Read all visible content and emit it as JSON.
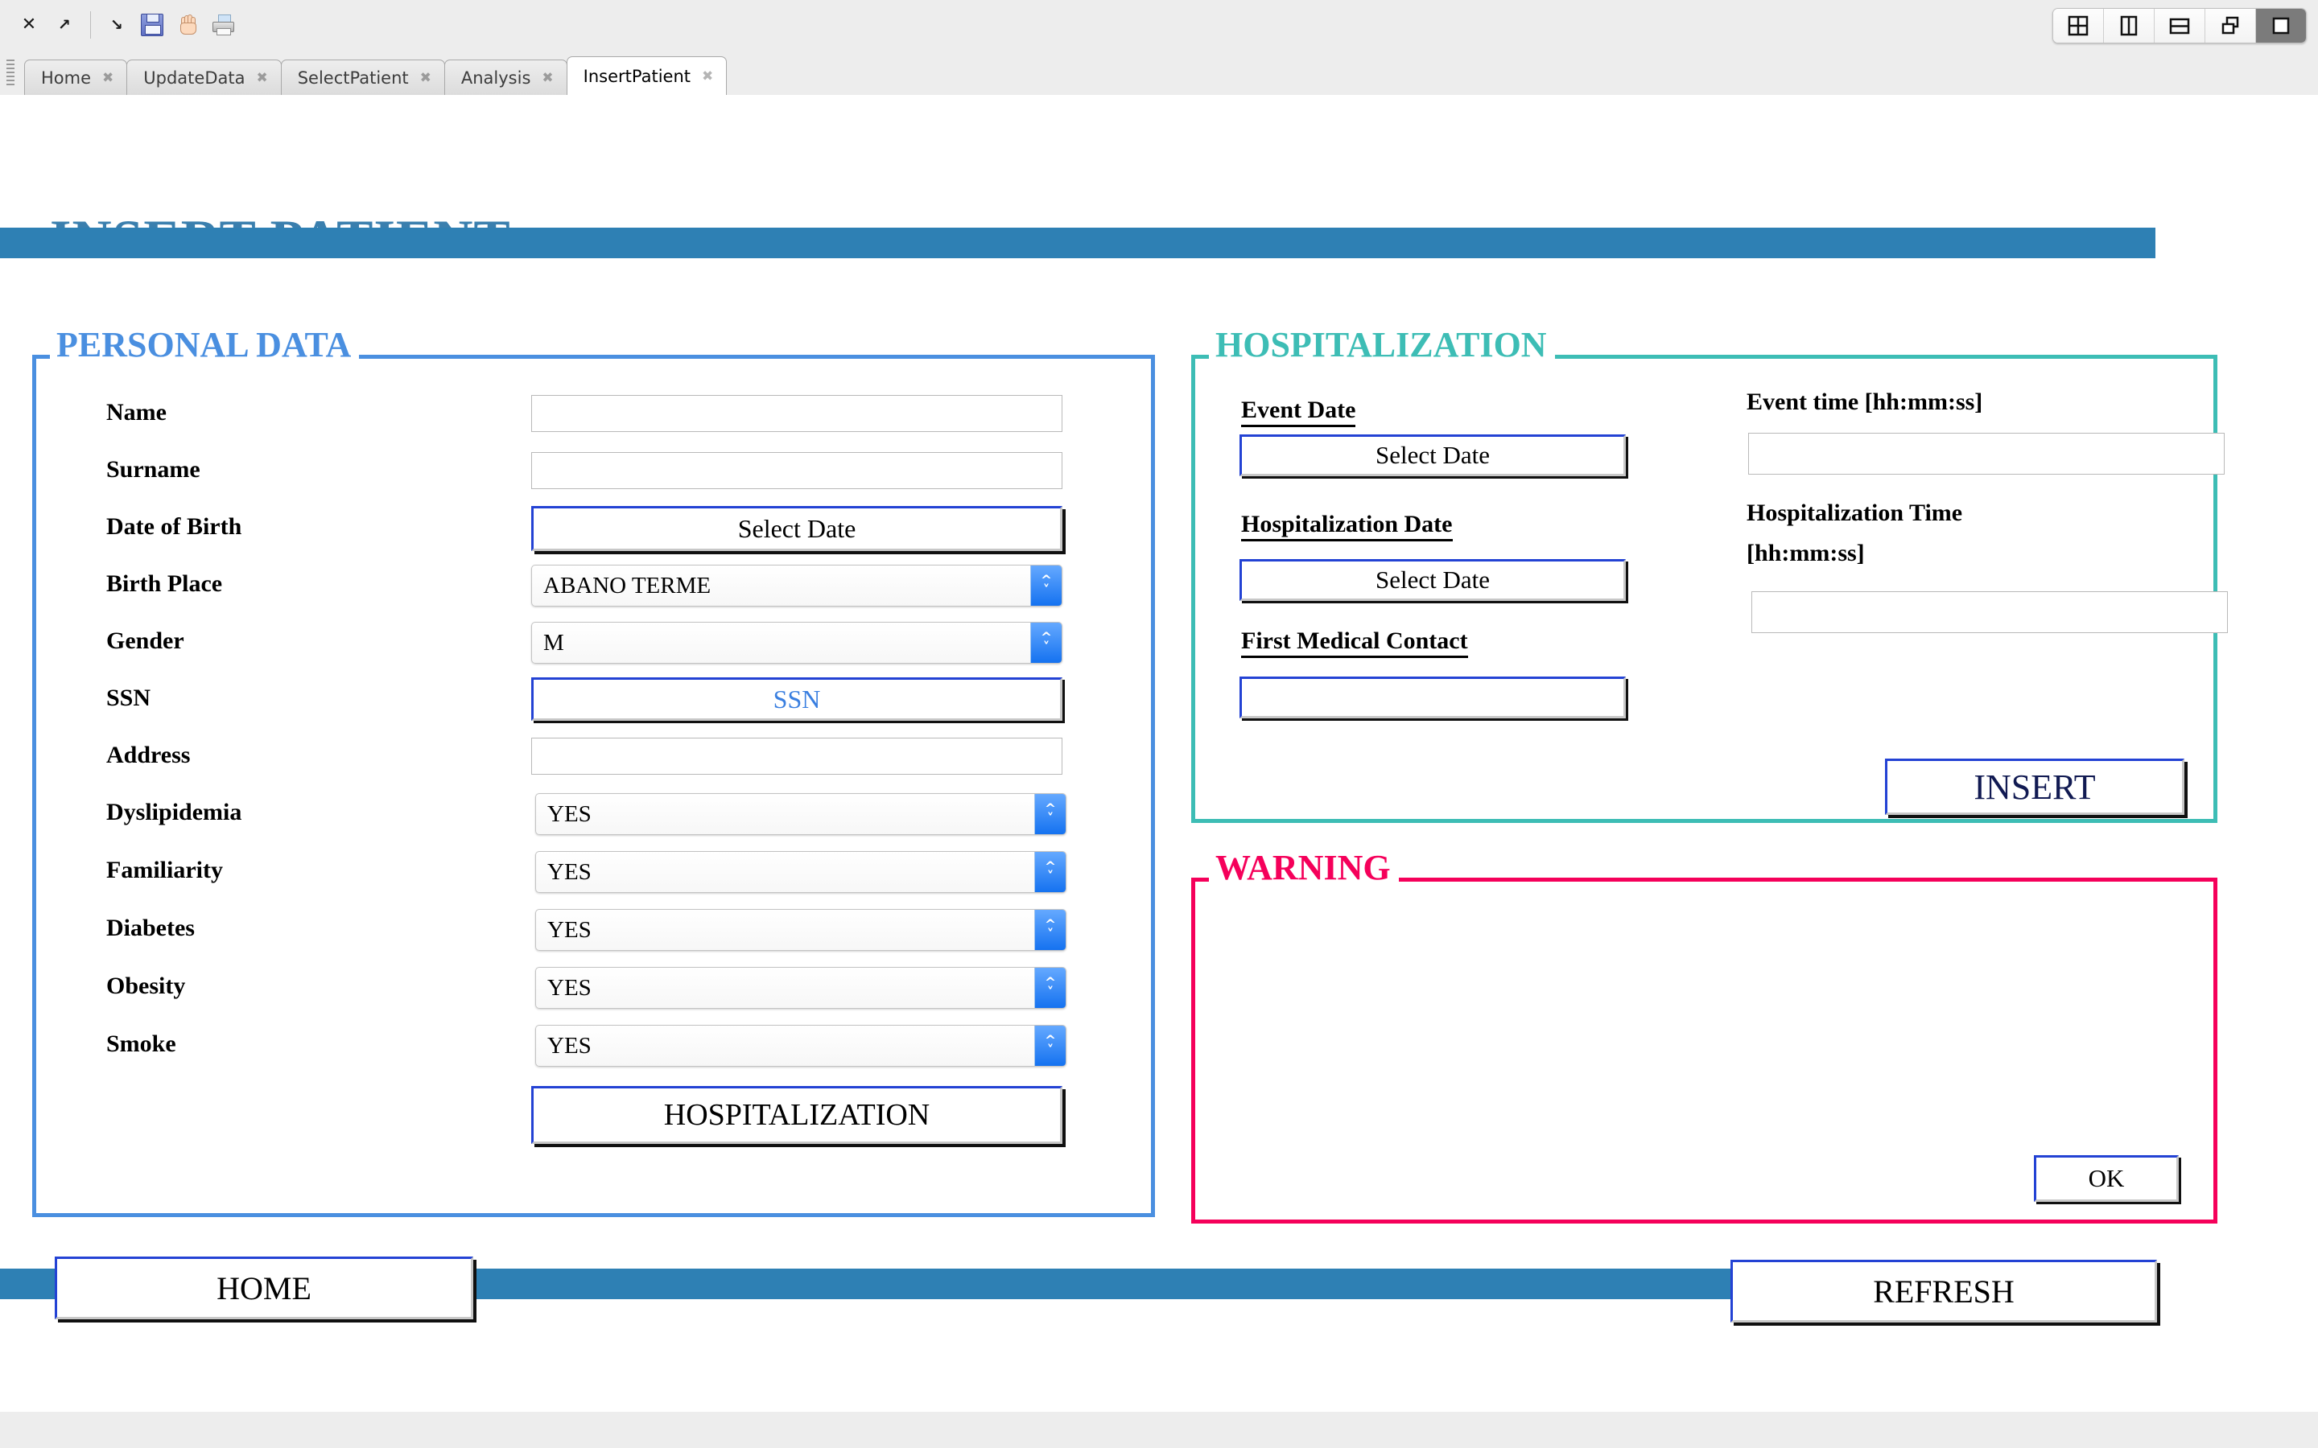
{
  "toolbar": {
    "icons": [
      {
        "name": "close-arrow-icon",
        "glyph": "✕"
      },
      {
        "name": "undock-arrow-icon",
        "glyph": "↗"
      },
      {
        "name": "dock-arrow-icon",
        "glyph": "↘"
      },
      {
        "name": "save-icon",
        "glyph": ""
      },
      {
        "name": "pan-hand-icon",
        "glyph": ""
      },
      {
        "name": "print-icon",
        "glyph": ""
      }
    ],
    "layout_buttons": [
      {
        "name": "layout-grid-button",
        "selected": false
      },
      {
        "name": "layout-two-columns-button",
        "selected": false
      },
      {
        "name": "layout-two-rows-button",
        "selected": false
      },
      {
        "name": "layout-cascade-button",
        "selected": false
      },
      {
        "name": "layout-single-button",
        "selected": true
      }
    ]
  },
  "tabs": [
    {
      "label": "Home",
      "active": false,
      "close": "✖"
    },
    {
      "label": "UpdateData",
      "active": false,
      "close": "✖"
    },
    {
      "label": "SelectPatient",
      "active": false,
      "close": "✖"
    },
    {
      "label": "Analysis",
      "active": false,
      "close": "✖"
    },
    {
      "label": "InsertPatient",
      "active": true,
      "close": "✖"
    }
  ],
  "page": {
    "title": "INSERT PATIENT",
    "accent_bar_color": "#2e80b4"
  },
  "personal_data": {
    "legend": "PERSONAL DATA",
    "legend_color": "#4a8fe0",
    "fields": [
      {
        "label": "Name",
        "type": "text",
        "value": "",
        "placeholder": ""
      },
      {
        "label": "Surname",
        "type": "text",
        "value": "",
        "placeholder": ""
      },
      {
        "label": "Date of Birth",
        "type": "button",
        "value": "Select Date"
      },
      {
        "label": "Birth Place",
        "type": "combo",
        "value": "ABANO TERME"
      },
      {
        "label": "Gender",
        "type": "combo",
        "value": "M"
      },
      {
        "label": "SSN",
        "type": "button-blue",
        "value": "SSN"
      },
      {
        "label": "Address",
        "type": "text",
        "value": "",
        "placeholder": ""
      },
      {
        "label": "Dyslipidemia",
        "type": "combo",
        "value": "YES"
      },
      {
        "label": "Familiarity",
        "type": "combo",
        "value": "YES"
      },
      {
        "label": "Diabetes",
        "type": "combo",
        "value": "YES"
      },
      {
        "label": "Obesity",
        "type": "combo",
        "value": "YES"
      },
      {
        "label": "Smoke",
        "type": "combo",
        "value": "YES"
      }
    ],
    "hospitalization_button": "HOSPITALIZATION"
  },
  "hospitalization": {
    "legend": "HOSPITALIZATION",
    "legend_color": "#3dbdb5",
    "event_date_label": "Event Date",
    "event_date_button": "Select Date",
    "hospitalization_date_label": "Hospitalization Date",
    "hospitalization_date_button": "Select Date",
    "first_medical_contact_label": "First Medical Contact",
    "first_medical_contact_value": "",
    "event_time_label": "Event time [hh:mm:ss]",
    "event_time_value": "",
    "hospitalization_time_label_line1": "Hospitalization Time",
    "hospitalization_time_label_line2": "[hh:mm:ss]",
    "hospitalization_time_value": "",
    "insert_button": "INSERT"
  },
  "warning": {
    "legend": "WARNING",
    "legend_color": "#f5005a",
    "message": "",
    "ok_button": "OK"
  },
  "footer": {
    "home_button": "HOME",
    "refresh_button": "REFRESH"
  }
}
